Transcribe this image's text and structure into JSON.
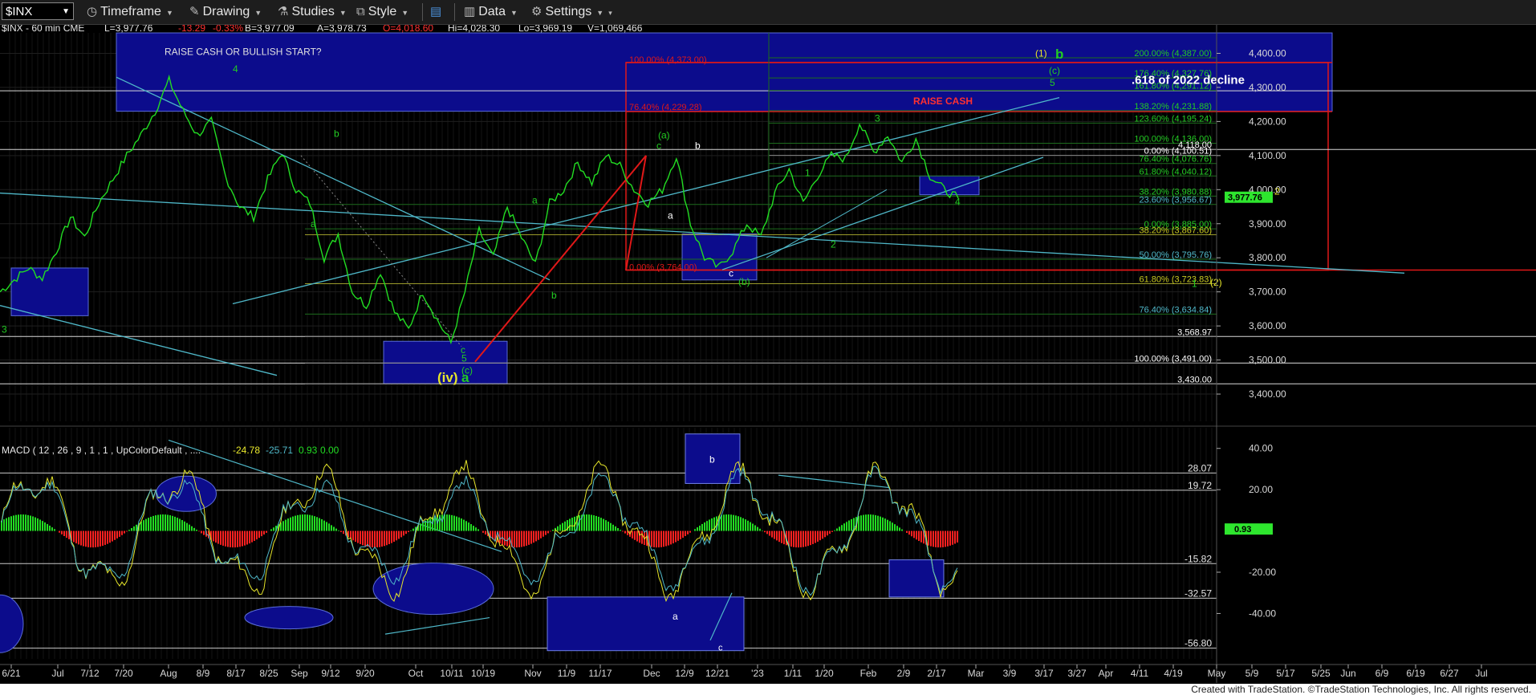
{
  "toolbar": {
    "symbol": "$INX",
    "timeframe": "Timeframe",
    "drawing": "Drawing",
    "studies": "Studies",
    "style": "Style",
    "data": "Data",
    "settings": "Settings"
  },
  "footer": {
    "credit": "Created with TradeStation. ©TradeStation Technologies, Inc. All rights reserved."
  },
  "colors": {
    "price": "#22dd22",
    "box": "#0c0c8c",
    "trend": "#4fb8c9",
    "red": "#e01818",
    "fib_yellow": "#9a9a2a",
    "fib_green": "#1d6b1d"
  },
  "chart_data": [
    {
      "type": "line",
      "header": "$INX - 60 min  CME",
      "quote": {
        "last": "L=3,977.76",
        "change": "-13.29",
        "pct": "-0.33%",
        "bid": "B=3,977.09",
        "ask": "A=3,978.73",
        "open": "O=4,018.60",
        "high": "Hi=4,028.30",
        "low": "Lo=3,969.19",
        "volume": "V=1,069,466"
      },
      "last_price_tag": "3,977.76",
      "ylim": [
        3320,
        4460
      ],
      "yticks": [
        "4,400.00",
        "4,300.00",
        "4,200.00",
        "4,100.00",
        "4,000.00",
        "3,900.00",
        "3,800.00",
        "3,700.00",
        "3,600.00",
        "3,500.00",
        "3,400.00"
      ],
      "ytick_values": [
        4400,
        4300,
        4200,
        4100,
        4000,
        3900,
        3800,
        3700,
        3600,
        3500,
        3400
      ],
      "xticks": [
        "6/21",
        "Jul",
        "7/12",
        "7/20",
        "Aug",
        "8/9",
        "8/17",
        "8/25",
        "Sep",
        "9/12",
        "9/20",
        "Oct",
        "10/11",
        "10/19",
        "Nov",
        "11/9",
        "11/17",
        "Dec",
        "12/9",
        "12/21",
        "'23",
        "1/11",
        "1/20",
        "Feb",
        "2/9",
        "2/17",
        "Mar",
        "3/9",
        "3/17",
        "3/27",
        "Apr",
        "4/11",
        "4/19",
        "May",
        "5/9",
        "5/17",
        "5/25",
        "Jun",
        "6/9",
        "6/19",
        "6/27",
        "Jul"
      ],
      "price_points": [
        [
          0,
          3700
        ],
        [
          2,
          3770
        ],
        [
          3,
          3740
        ],
        [
          4,
          3820
        ],
        [
          5,
          3920
        ],
        [
          6,
          3860
        ],
        [
          7,
          3960
        ],
        [
          8,
          4030
        ],
        [
          9,
          4100
        ],
        [
          10,
          4160
        ],
        [
          11,
          4230
        ],
        [
          12,
          4320
        ],
        [
          13,
          4230
        ],
        [
          14,
          4160
        ],
        [
          15,
          4200
        ],
        [
          16,
          4040
        ],
        [
          17,
          3950
        ],
        [
          18,
          3920
        ],
        [
          19,
          4030
        ],
        [
          20,
          4110
        ],
        [
          21,
          4000
        ],
        [
          22,
          3960
        ],
        [
          23,
          3800
        ],
        [
          24,
          3870
        ],
        [
          25,
          3700
        ],
        [
          26,
          3660
        ],
        [
          27,
          3760
        ],
        [
          28,
          3640
        ],
        [
          29,
          3590
        ],
        [
          30,
          3700
        ],
        [
          31,
          3620
        ],
        [
          32,
          3550
        ],
        [
          33,
          3700
        ],
        [
          34,
          3880
        ],
        [
          35,
          3800
        ],
        [
          36,
          3950
        ],
        [
          37,
          3860
        ],
        [
          38,
          3780
        ],
        [
          39,
          3960
        ],
        [
          40,
          4000
        ],
        [
          41,
          4080
        ],
        [
          42,
          4020
        ],
        [
          43,
          4100
        ],
        [
          44,
          4070
        ],
        [
          45,
          4000
        ],
        [
          46,
          3960
        ],
        [
          47,
          4000
        ],
        [
          48,
          4100
        ],
        [
          49,
          3900
        ],
        [
          50,
          3800
        ],
        [
          51,
          3770
        ],
        [
          52,
          3820
        ],
        [
          53,
          3900
        ],
        [
          54,
          3860
        ],
        [
          55,
          3990
        ],
        [
          56,
          4060
        ],
        [
          57,
          3960
        ],
        [
          58,
          4040
        ],
        [
          59,
          4100
        ],
        [
          60,
          4090
        ],
        [
          61,
          4195
        ],
        [
          62,
          4110
        ],
        [
          63,
          4160
        ],
        [
          64,
          4080
        ],
        [
          65,
          4150
        ],
        [
          66,
          4040
        ],
        [
          67,
          4000
        ],
        [
          68,
          3975
        ]
      ],
      "fib_levels": [
        {
          "label": "200.00% (4,387.00)",
          "value": 4387,
          "color": "#22cc22"
        },
        {
          "label": "176.40% (4,327.76)",
          "value": 4327.76,
          "color": "#22cc22"
        },
        {
          "label": "161.80% (4,291.12)",
          "value": 4291.12,
          "color": "#22cc22"
        },
        {
          "label": "138.20% (4,231.88)",
          "value": 4231.88,
          "color": "#22cc22"
        },
        {
          "label": "123.60% (4,195.24)",
          "value": 4195.24,
          "color": "#22cc22"
        },
        {
          "label": "100.00% (4,136.00)",
          "value": 4136,
          "color": "#22cc22"
        },
        {
          "label": "4,118.00",
          "value": 4118,
          "color": "#ffffff"
        },
        {
          "label": "0.00% (4,100.51)",
          "value": 4100.51,
          "color": "#ffffff"
        },
        {
          "label": "76.40% (4,076.76)",
          "value": 4076.76,
          "color": "#22cc22"
        },
        {
          "label": "61.80% (4,040.12)",
          "value": 4040.12,
          "color": "#22cc22"
        },
        {
          "label": "38.20% (3,980.88)",
          "value": 3980.88,
          "color": "#22cc22"
        },
        {
          "label": "23.60% (3,956.67)",
          "value": 3956.67,
          "color": "#4fb8c9"
        },
        {
          "label": "0.00% (3,885.00)",
          "value": 3885,
          "color": "#22cc22"
        },
        {
          "label": "38.20% (3,867.60)",
          "value": 3867.6,
          "color": "#c8c820"
        },
        {
          "label": "50.00% (3,795.76)",
          "value": 3795.76,
          "color": "#4fb8c9"
        },
        {
          "label": "61.80% (3,723.83)",
          "value": 3723.83,
          "color": "#c8c820"
        },
        {
          "label": "76.40% (3,634.84)",
          "value": 3634.84,
          "color": "#4fb8c9"
        },
        {
          "label": "3,568.97",
          "value": 3568.97,
          "color": "#ffffff"
        },
        {
          "label": "100.00% (3,491.00)",
          "value": 3491,
          "color": "#ffffff"
        },
        {
          "label": "3,430.00",
          "value": 3430,
          "color": "#ffffff"
        }
      ],
      "red_fib_labels": [
        {
          "label": "100.00% (4,373.00)",
          "value": 4373
        },
        {
          "label": "76.40% (4,229.28)",
          "value": 4229.28
        },
        {
          "label": "0.00% (3,764.00)",
          "value": 3764
        }
      ],
      "annotations": [
        {
          "text": "RAISE CASH OR BULLISH START?",
          "color": "#e0e0e0"
        },
        {
          "text": ".618 of 2022 decline",
          "color": "#ffffff"
        },
        {
          "text": "RAISE CASH",
          "color": "#ff3030"
        }
      ],
      "wave_labels": [
        {
          "text": "4",
          "color": "#22cc22"
        },
        {
          "text": "3",
          "color": "#22cc22"
        },
        {
          "text": "a",
          "color": "#22cc22"
        },
        {
          "text": "b",
          "color": "#22cc22"
        },
        {
          "text": "a",
          "color": "#22cc22"
        },
        {
          "text": "b",
          "color": "#22cc22"
        },
        {
          "text": "c",
          "color": "#22cc22"
        },
        {
          "text": "5",
          "color": "#22cc22"
        },
        {
          "text": "(c)",
          "color": "#22cc22"
        },
        {
          "text": "a",
          "color": "#22cc22"
        },
        {
          "text": "(iv)",
          "color": "#e6e62a"
        },
        {
          "text": "(a)",
          "color": "#22cc22"
        },
        {
          "text": "c",
          "color": "#22cc22"
        },
        {
          "text": "b",
          "color": "#ffffff"
        },
        {
          "text": "a",
          "color": "#ffffff"
        },
        {
          "text": "c",
          "color": "#ffffff"
        },
        {
          "text": "(b)",
          "color": "#22cc22"
        },
        {
          "text": "1",
          "color": "#22cc22"
        },
        {
          "text": "2",
          "color": "#22cc22"
        },
        {
          "text": "3",
          "color": "#22cc22"
        },
        {
          "text": "4",
          "color": "#22cc22"
        },
        {
          "text": "(1)",
          "color": "#e6e62a"
        },
        {
          "text": "b",
          "color": "#22cc22"
        },
        {
          "text": "(c)",
          "color": "#22cc22"
        },
        {
          "text": "5",
          "color": "#22cc22"
        },
        {
          "text": "2",
          "color": "#e6e62a"
        },
        {
          "text": "1",
          "color": "#22cc22"
        },
        {
          "text": "(2)",
          "color": "#e6e62a"
        }
      ]
    },
    {
      "type": "bar",
      "title": "MACD ( 12 , 26 , 9 , 1 , 1 , UpColorDefault , ....",
      "values": [
        "-24.78",
        "-25.71",
        "0.93",
        "0.00"
      ],
      "ylim": [
        -62,
        50
      ],
      "yticks": [
        "40.00",
        "20.00",
        "-20.00",
        "-40.00"
      ],
      "ytick_values": [
        40,
        20,
        -20,
        -40
      ],
      "level_labels": [
        "28.07",
        "19.72",
        "-15.82",
        "-32.57",
        "-56.80"
      ],
      "level_values": [
        28.07,
        19.72,
        -15.82,
        -32.57,
        -56.8
      ],
      "last_value_tag": "0.93",
      "box_labels": [
        "b",
        "a",
        "c"
      ]
    }
  ]
}
